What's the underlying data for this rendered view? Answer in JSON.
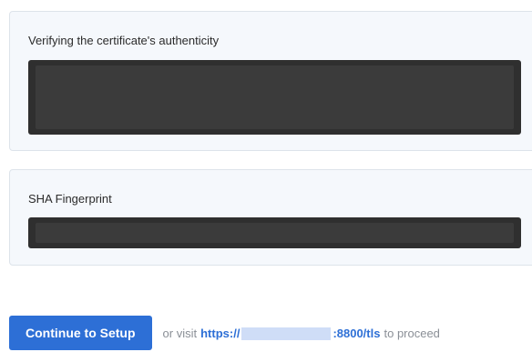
{
  "certificate": {
    "title": "Verifying the certificate's authenticity"
  },
  "fingerprint": {
    "title": "SHA Fingerprint"
  },
  "actions": {
    "continue_label": "Continue to Setup",
    "or_visit": "or visit",
    "url_prefix": "https://",
    "url_suffix": ":8800/tls",
    "to_proceed": "to proceed"
  },
  "colors": {
    "primary": "#2d6fd6",
    "card_bg": "#f5f8fc",
    "redacted": "#2f2f2f"
  }
}
